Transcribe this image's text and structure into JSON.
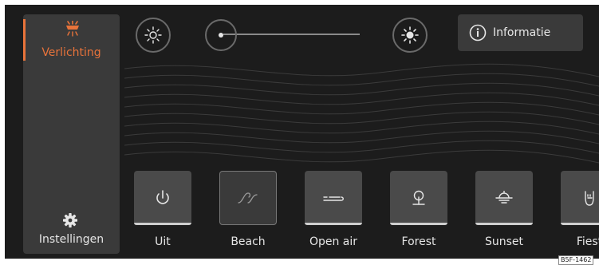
{
  "sidebar": {
    "active_tab": {
      "label": "Verlichting",
      "icon": "lamp-icon"
    },
    "settings": {
      "label": "Instellingen",
      "icon": "gear-icon"
    }
  },
  "brightness": {
    "min_icon": "sun-dim-icon",
    "max_icon": "sun-bright-icon",
    "level": 0.1
  },
  "info_button": {
    "label": "Informatie",
    "icon": "info-icon"
  },
  "modes": [
    {
      "label": "Uit",
      "icon": "power-icon",
      "selected": false
    },
    {
      "label": "Beach",
      "icon": "wave-icon",
      "selected": true
    },
    {
      "label": "Open air",
      "icon": "wind-icon",
      "selected": false
    },
    {
      "label": "Forest",
      "icon": "tree-icon",
      "selected": false
    },
    {
      "label": "Sunset",
      "icon": "sunset-icon",
      "selected": false
    },
    {
      "label": "Fiest",
      "icon": "rock-hand-icon",
      "selected": false
    }
  ],
  "colors": {
    "accent": "#e8733a",
    "background": "#1c1c1c",
    "panel": "#3a3a3a",
    "tile": "#4a4a4a"
  },
  "ref_code": "B5F-1462"
}
